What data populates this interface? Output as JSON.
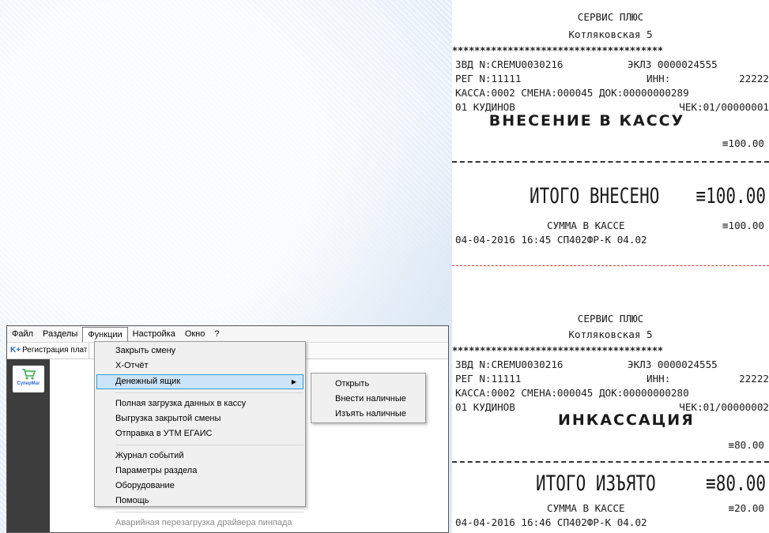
{
  "app": {
    "menubar": [
      "Файл",
      "Разделы",
      "Функции",
      "Настройка",
      "Окно",
      "?"
    ],
    "active_menu_index": 2,
    "tab_label": "Регистрация плат",
    "logo_text": "СуперМаг"
  },
  "functions_menu": {
    "group1": [
      "Закрыть смену",
      "Х-Отчёт",
      "Денежный ящик"
    ],
    "selected": "Денежный ящик",
    "group2": [
      "Полная загрузка данных в кассу",
      "Выгрузка закрытой смены",
      "Отправка в УТМ ЕГАИС"
    ],
    "group3": [
      "Журнал событий",
      "Параметры раздела",
      "Оборудование",
      "Помощь"
    ],
    "disabled_item": "Аварийная перезагрузка драйвера пинпада"
  },
  "cashbox_submenu": [
    "Открыть",
    "Внести наличные",
    "Изъять наличные"
  ],
  "receipts": [
    {
      "company": "СЕРВИС ПЛЮС",
      "address": "Котляковская 5",
      "stars": "**************************************",
      "zvd": "ЗВД N:CREMU0030216",
      "eklz": "ЭКЛЗ 0000024555",
      "reg": "РЕГ N:11111",
      "inn_label": "ИНН:",
      "inn": "22222",
      "kassa": "КАССА:0002 СМЕНА:000045 ДОК:00000000289",
      "cashier": "01 КУДИНОВ",
      "check": "ЧЕК:01/00000001",
      "operation": "ВНЕСЕНИЕ В КАССУ",
      "amount": "≡100.00",
      "total_label": "ИТОГО ВНЕСЕНО",
      "total_amount": "≡100.00",
      "balance_label": "СУММА В КАССЕ",
      "balance_amount": "≡100.00",
      "footer": "04-04-2016 16:45 СП402ФР-К 04.02"
    },
    {
      "company": "СЕРВИС ПЛЮС",
      "address": "Котляковская 5",
      "stars": "**************************************",
      "zvd": "ЗВД N:CREMU0030216",
      "eklz": "ЭКЛЗ 0000024555",
      "reg": "РЕГ N:11111",
      "inn_label": "ИНН:",
      "inn": "22222",
      "kassa": "КАССА:0002 СМЕНА:000045 ДОК:00000000280",
      "cashier": "01 КУДИНОВ",
      "check": "ЧЕК:01/00000002",
      "operation": "ИНКАССАЦИЯ",
      "amount": "≡80.00",
      "total_label": "ИТОГО ИЗЪЯТО",
      "total_amount": "≡80.00",
      "balance_label": "СУММА В КАССЕ",
      "balance_amount": "≡20.00",
      "footer": "04-04-2016 16:46 СП402ФР-К 04.02"
    }
  ],
  "colors": {
    "selection": "#cce4f7",
    "selection_border": "#26a0da",
    "cut_line": "#e53030",
    "side_panel": "#3d3d3d"
  }
}
